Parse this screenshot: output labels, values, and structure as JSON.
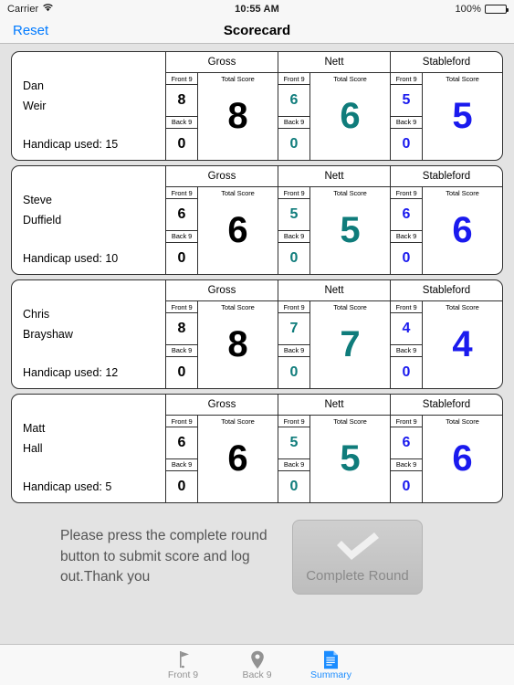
{
  "status_bar": {
    "carrier": "Carrier",
    "wifi_icon": "wifi-icon",
    "time": "10:55 AM",
    "battery_percent": "100%",
    "battery_icon": "battery-full-icon"
  },
  "nav_bar": {
    "reset_label": "Reset",
    "title": "Scorecard"
  },
  "column_groups": {
    "gross": "Gross",
    "nett": "Nett",
    "stableford": "Stableford"
  },
  "cell_labels": {
    "front": "Front 9",
    "back": "Back 9",
    "total": "Total Score"
  },
  "colors": {
    "gross": "#000000",
    "nett": "#0f7c7b",
    "stableford": "#1a1aee",
    "accent": "#007aff",
    "tab_active": "#1a8cff",
    "tab_inactive": "#929292",
    "background": "#e3e3e3"
  },
  "players": [
    {
      "first_name": "Dan",
      "last_name": "Weir",
      "handicap_label": "Handicap used: 15",
      "gross": {
        "front": "8",
        "back": "0",
        "total": "8"
      },
      "nett": {
        "front": "6",
        "back": "0",
        "total": "6"
      },
      "stableford": {
        "front": "5",
        "back": "0",
        "total": "5"
      }
    },
    {
      "first_name": "Steve",
      "last_name": "Duffield",
      "handicap_label": "Handicap used: 10",
      "gross": {
        "front": "6",
        "back": "0",
        "total": "6"
      },
      "nett": {
        "front": "5",
        "back": "0",
        "total": "5"
      },
      "stableford": {
        "front": "6",
        "back": "0",
        "total": "6"
      }
    },
    {
      "first_name": "Chris",
      "last_name": "Brayshaw",
      "handicap_label": "Handicap used: 12",
      "gross": {
        "front": "8",
        "back": "0",
        "total": "8"
      },
      "nett": {
        "front": "7",
        "back": "0",
        "total": "7"
      },
      "stableford": {
        "front": "4",
        "back": "0",
        "total": "4"
      }
    },
    {
      "first_name": "Matt",
      "last_name": "Hall",
      "handicap_label": "Handicap used: 5",
      "gross": {
        "front": "6",
        "back": "0",
        "total": "6"
      },
      "nett": {
        "front": "5",
        "back": "0",
        "total": "5"
      },
      "stableford": {
        "front": "6",
        "back": "0",
        "total": "6"
      }
    }
  ],
  "footer": {
    "instructions": "Please press the complete round button to submit score and log out.Thank you",
    "complete_button_label": "Complete Round",
    "complete_button_icon": "checkmark-icon"
  },
  "tab_bar": {
    "items": [
      {
        "label": "Front 9",
        "icon": "golf-flag-icon",
        "active": false
      },
      {
        "label": "Back 9",
        "icon": "map-pin-icon",
        "active": false
      },
      {
        "label": "Summary",
        "icon": "document-icon",
        "active": true
      }
    ]
  }
}
